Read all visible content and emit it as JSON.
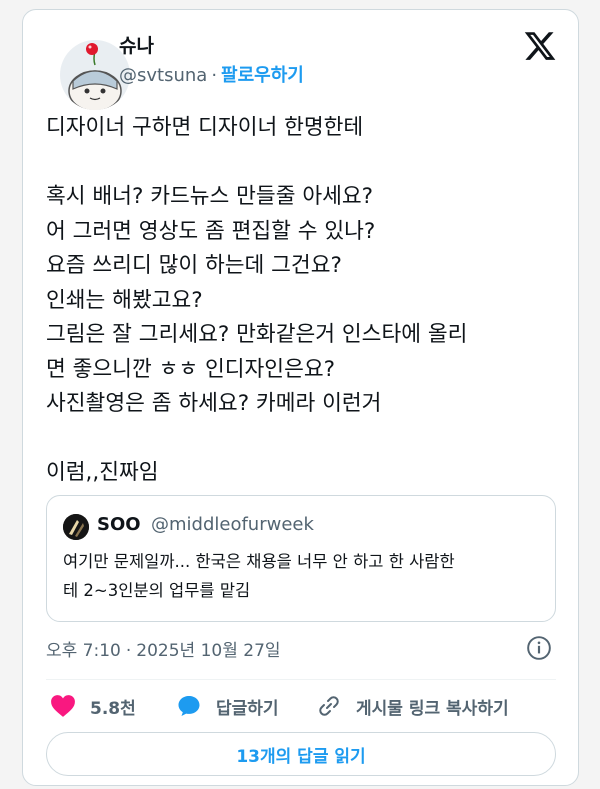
{
  "author": {
    "name": "슈나",
    "handle": "@svtsuna",
    "separator": "·",
    "follow_label": "팔로우하기"
  },
  "post": {
    "lines": [
      "디자이너 구하면 디자이너 한명한테",
      "",
      "혹시 배너? 카드뉴스 만들줄 아세요?",
      "어 그러면 영상도 좀 편집할 수 있나?",
      "요즘 쓰리디 많이 하는데 그건요?",
      "인쇄는 해봤고요?",
      "그림은 잘 그리세요? 만화같은거 인스타에 올리",
      "면 좋으니깐 ㅎㅎ 인디자인은요?",
      "사진촬영은 좀 하세요? 카메라 이런거",
      "",
      "이럼,,진짜임"
    ]
  },
  "quote": {
    "name": "SOO",
    "handle": "@middleofurweek",
    "lines": [
      "여기만 문제일까... 한국은 채용을 너무 안 하고 한 사람한",
      "테 2~3인분의 업무를 맡김"
    ]
  },
  "meta": {
    "time": "오후 7:10",
    "separator": "·",
    "date": "2025년 10월 27일"
  },
  "actions": {
    "like_count": "5.8천",
    "reply_label": "답글하기",
    "share_label": "게시물 링크 복사하기"
  },
  "read_replies_label": "13개의 답글 읽기",
  "colors": {
    "accent": "#1d9bf0",
    "like": "#f91880",
    "muted": "#536471",
    "text": "#0f1419",
    "border": "#cfd9de"
  }
}
